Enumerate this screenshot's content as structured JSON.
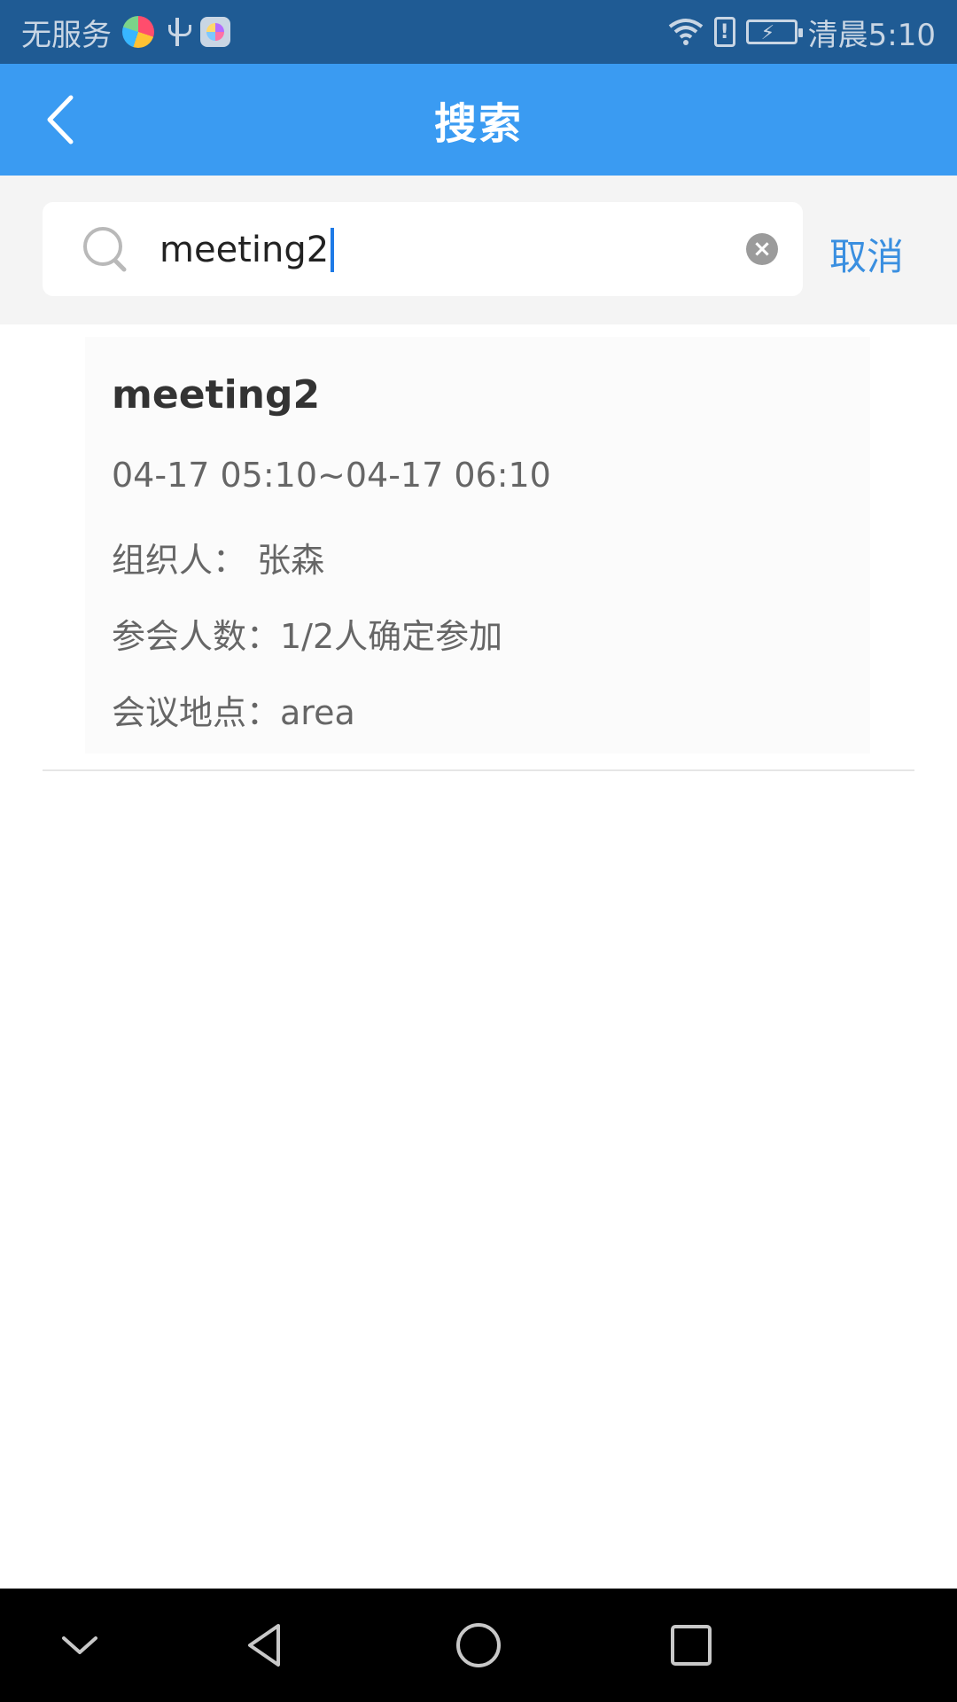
{
  "status_bar": {
    "carrier": "无服务",
    "time": "清晨5:10",
    "icons": [
      "colorful-app-icon",
      "usb-icon",
      "app-square-icon",
      "wifi-icon",
      "alert-icon",
      "battery-charging-icon"
    ]
  },
  "header": {
    "title": "搜索",
    "back_icon": "chevron-left-icon"
  },
  "search": {
    "value": "meeting2",
    "cancel_label": "取消",
    "icons": [
      "search-icon",
      "clear-icon"
    ]
  },
  "result": {
    "title": "meeting2",
    "time_range": "04-17 05:10~04-17 06:10",
    "organizer": "组织人： 张森",
    "participants": "参会人数：1/2人确定参加",
    "location": "会议地点：area"
  },
  "nav": {
    "icons": [
      "chevron-down-icon",
      "back-triangle-icon",
      "home-circle-icon",
      "recent-square-icon"
    ]
  },
  "colors": {
    "status_bar": "#1f5b94",
    "header": "#3a9bf2",
    "accent": "#3a8fe0",
    "cursor": "#1e7ae6"
  }
}
